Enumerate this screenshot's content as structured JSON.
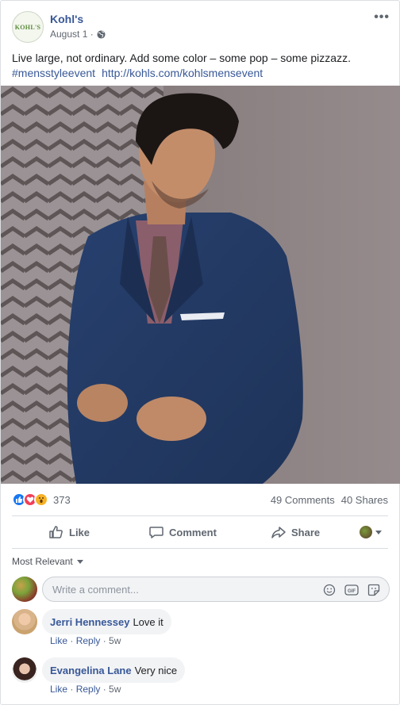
{
  "post": {
    "page_name": "Kohl's",
    "page_logo_text": "KOHL'S",
    "date": "August 1 ·",
    "privacy_icon": "globe-icon",
    "more_label": "•••",
    "text": "Live large, not ordinary. Add some color – some pop – some pizzazz.",
    "hashtag": "#mensstyleevent",
    "link": "http://kohls.com/kohlsmensevent"
  },
  "reactions": {
    "icons": [
      "like-reaction-icon",
      "love-reaction-icon",
      "wow-reaction-icon"
    ],
    "count": "373",
    "comments": "49 Comments",
    "shares": "40 Shares"
  },
  "actions": {
    "like": "Like",
    "comment": "Comment",
    "share": "Share"
  },
  "comments_section": {
    "sort_label": "Most Relevant",
    "composer_placeholder": "Write a comment...",
    "composer_icons": [
      "emoji-icon",
      "gif-icon",
      "sticker-icon"
    ],
    "items": [
      {
        "name": "Jerri Hennessey",
        "text": "Love it",
        "like": "Like",
        "reply": "Reply",
        "time": "5w"
      },
      {
        "name": "Evangelina Lane",
        "text": "Very nice",
        "like": "Like",
        "reply": "Reply",
        "time": "5w"
      }
    ]
  },
  "colors": {
    "link_blue": "#385898",
    "like_blue": "#1877f2",
    "love_red": "#f33e58",
    "wow_yellow": "#f7b125"
  }
}
